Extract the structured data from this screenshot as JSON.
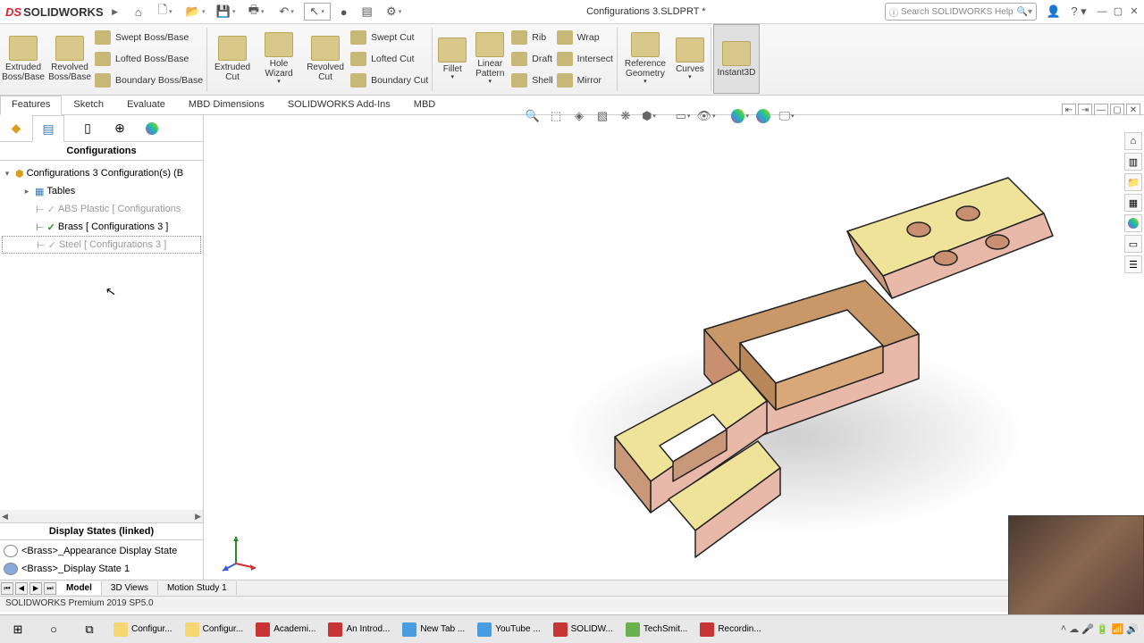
{
  "title": "Configurations 3.SLDPRT *",
  "logo": {
    "ds": "DS",
    "sw": "SOLIDWORKS"
  },
  "search_placeholder": "Search SOLIDWORKS Help",
  "ribbon": {
    "extruded_boss": "Extruded Boss/Base",
    "revolved_boss": "Revolved Boss/Base",
    "swept": "Swept Boss/Base",
    "lofted": "Lofted Boss/Base",
    "boundary": "Boundary Boss/Base",
    "extruded_cut": "Extruded Cut",
    "hole": "Hole Wizard",
    "revolved_cut": "Revolved Cut",
    "swept_cut": "Swept Cut",
    "lofted_cut": "Lofted Cut",
    "boundary_cut": "Boundary Cut",
    "fillet": "Fillet",
    "linear": "Linear Pattern",
    "rib": "Rib",
    "draft": "Draft",
    "shell": "Shell",
    "wrap": "Wrap",
    "intersect": "Intersect",
    "mirror": "Mirror",
    "ref_geom": "Reference Geometry",
    "curves": "Curves",
    "instant3d": "Instant3D"
  },
  "ribbon_tabs": [
    "Features",
    "Sketch",
    "Evaluate",
    "MBD Dimensions",
    "SOLIDWORKS Add-Ins",
    "MBD"
  ],
  "side_title": "Configurations",
  "tree": {
    "root": "Configurations 3 Configuration(s)  (B",
    "tables": "Tables",
    "abs": "ABS Plastic [ Configurations",
    "brass": "Brass [ Configurations 3 ]",
    "steel": "Steel [ Configurations 3 ]"
  },
  "display_states_hdr": "Display States (linked)",
  "display_states": [
    "<Brass>_Appearance Display State",
    "<Brass>_Display State 1"
  ],
  "bottom_tabs": [
    "Model",
    "3D Views",
    "Motion Study 1"
  ],
  "status": "SOLIDWORKS Premium 2019 SP5.0",
  "taskbar": [
    {
      "label": "Configur...",
      "color": "#f7d774"
    },
    {
      "label": "Configur...",
      "color": "#f7d774"
    },
    {
      "label": "Academi...",
      "color": "#c93434"
    },
    {
      "label": "An Introd...",
      "color": "#c93434"
    },
    {
      "label": "New Tab ...",
      "color": "#4a9de0"
    },
    {
      "label": "YouTube ...",
      "color": "#4a9de0"
    },
    {
      "label": "SOLIDW...",
      "color": "#c93434"
    },
    {
      "label": "TechSmit...",
      "color": "#6ab04c"
    },
    {
      "label": "Recordin...",
      "color": "#c93434"
    }
  ]
}
